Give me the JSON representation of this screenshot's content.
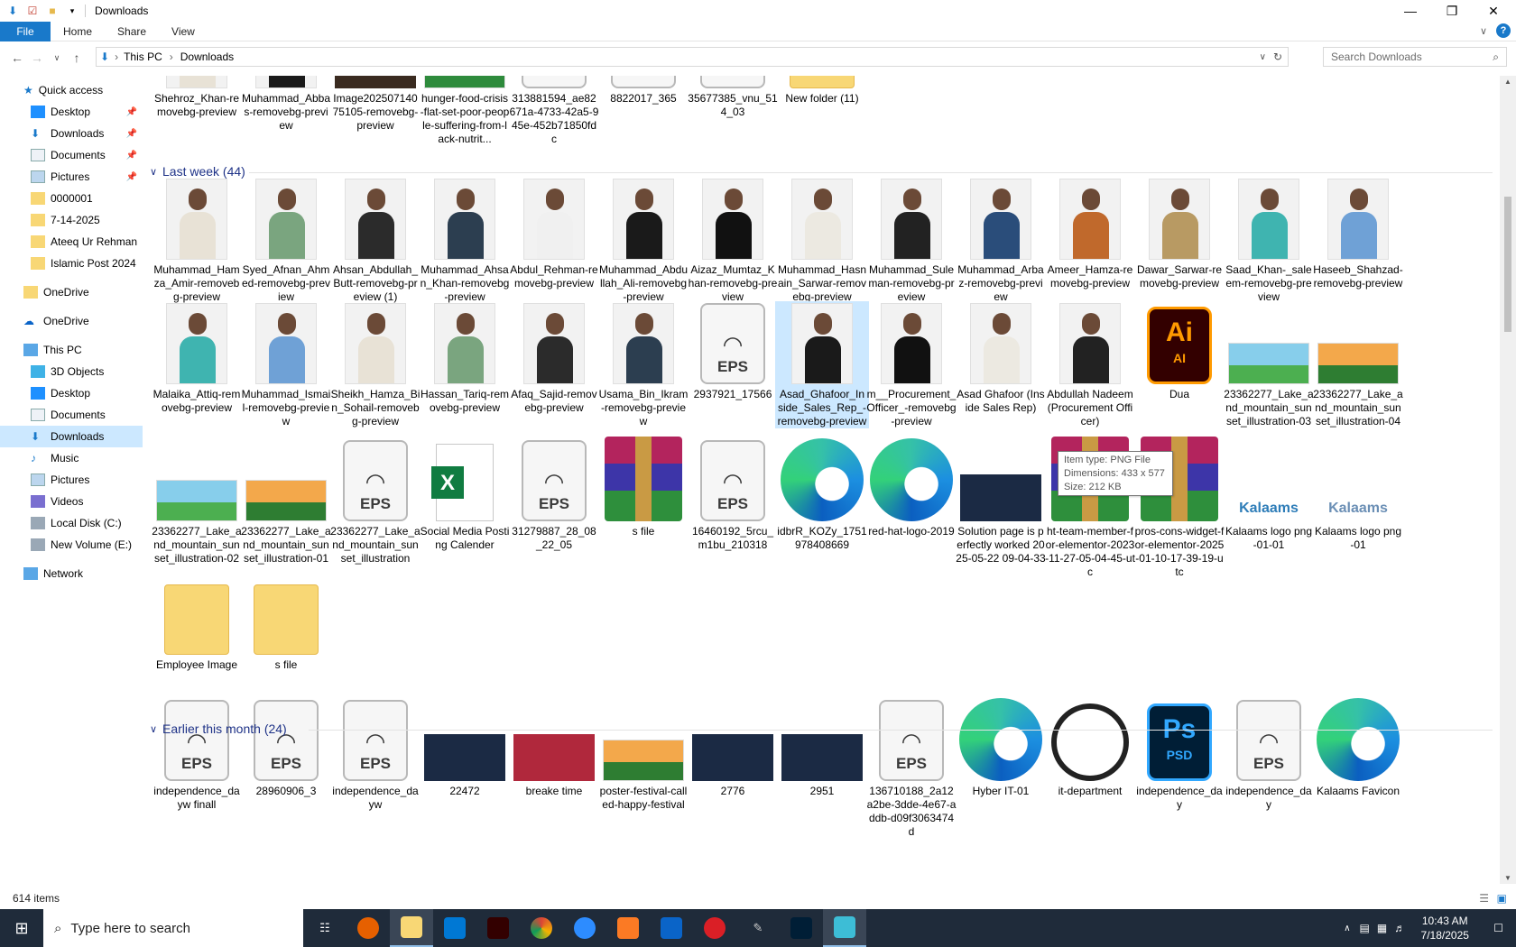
{
  "window": {
    "title": "Downloads"
  },
  "ribbon": {
    "tabs": [
      "File",
      "Home",
      "Share",
      "View"
    ]
  },
  "address": {
    "parts": [
      "This PC",
      "Downloads"
    ],
    "search_placeholder": "Search Downloads"
  },
  "nav": {
    "quick_access": "Quick access",
    "items": [
      {
        "label": "Desktop",
        "pinned": true
      },
      {
        "label": "Downloads",
        "pinned": true
      },
      {
        "label": "Documents",
        "pinned": true
      },
      {
        "label": "Pictures",
        "pinned": true
      },
      {
        "label": "0000001"
      },
      {
        "label": "7-14-2025"
      },
      {
        "label": "Ateeq Ur Rehman"
      },
      {
        "label": "Islamic Post 2024"
      }
    ],
    "onedrive1": "OneDrive",
    "onedrive2": "OneDrive",
    "this_pc": "This PC",
    "pc_items": [
      "3D Objects",
      "Desktop",
      "Documents",
      "Downloads",
      "Music",
      "Pictures",
      "Videos",
      "Local Disk (C:)",
      "New Volume (E:)"
    ],
    "network": "Network"
  },
  "groups": {
    "last_week": "Last week (44)",
    "earlier": "Earlier this month (24)"
  },
  "top_row": [
    "Shehroz_Khan-removebg-preview",
    "Muhammad_Abbas-removebg-preview",
    "Image20250714075105-removebg-preview",
    "hunger-food-crisis-flat-set-poor-people-suffering-from-lack-nutrit...",
    "313881594_ae82671a-4733-42a5-945e-452b71850fdc",
    "8822017_365",
    "35677385_vnu_514_03",
    "New folder (11)"
  ],
  "row1": [
    "Muhammad_Hamza_Amir-removebg-preview",
    "Syed_Afnan_Ahmed-removebg-preview",
    "Ahsan_Abdullah_Butt-removebg-preview (1)",
    "Muhammad_Ahsan_Khan-removebg-preview",
    "Abdul_Rehman-removebg-preview",
    "Muhammad_Abdullah_Ali-removebg-preview",
    "Aizaz_Mumtaz_Khan-removebg-preview",
    "Muhammad_Hasnain_Sarwar-removebg-preview",
    "Muhammad_Suleman-removebg-preview",
    "Muhammad_Arbaz-removebg-preview",
    "Ameer_Hamza-removebg-preview",
    "Dawar_Sarwar-removebg-preview",
    "Saad_Khan-_saleem-removebg-preview",
    "Haseeb_Shahzad-removebg-preview"
  ],
  "row2": [
    "Malaika_Attiq-removebg-preview",
    "Muhammad_Ismail-removebg-preview",
    "Sheikh_Hamza_Bin_Sohail-removebg-preview",
    "Hassan_Tariq-removebg-preview",
    "Afaq_Sajid-removebg-preview",
    "Usama_Bin_Ikram-removebg-preview",
    "2937921_17566",
    "Asad_Ghafoor_Inside_Sales_Rep_-removebg-preview",
    "m__Procurement_Officer_-removebg-preview",
    "Asad Ghafoor (Inside Sales Rep)",
    "Abdullah Nadeem (Procurement Officer)",
    "Dua",
    "23362277_Lake_and_mountain_sunset_illustration-03",
    "23362277_Lake_and_mountain_sunset_illustration-04"
  ],
  "row3": [
    "23362277_Lake_and_mountain_sunset_illustration-02",
    "23362277_Lake_and_mountain_sunset_illustration-01",
    "23362277_Lake_and_mountain_sunset_illustration",
    "Social Media Posting Calender",
    "31279887_28_08_22_05",
    "s file",
    "16460192_5rcu_m1bu_210318",
    "idbrR_KOZy_1751978408669",
    "red-hat-logo-2019",
    "Solution page is perfectly worked 2025-05-22 09-04-33",
    "ht-team-member-for-elementor-2023-11-27-05-04-45-utc",
    "pros-cons-widget-for-elementor-2025-01-10-17-39-19-utc",
    "Kalaams logo png-01-01",
    "Kalaams logo png-01"
  ],
  "row4": [
    "Employee Image",
    "s file"
  ],
  "row5": [
    "independence_dayw finall",
    "28960906_3",
    "independence_dayw",
    "22472",
    "breake time",
    "poster-festival-called-happy-festival",
    "2776",
    "2951",
    "136710188_2a12a2be-3dde-4e67-addb-d09f3063474d",
    "Hyber IT-01",
    "it-department",
    "independence_day",
    "independence_day",
    "Kalaams Favicon"
  ],
  "tooltip": {
    "line1": "Item type: PNG File",
    "line2": "Dimensions: 433 x 577",
    "line3": "Size: 212 KB"
  },
  "eps_label": "EPS",
  "ai_label": "Ai",
  "ai_sub": "AI",
  "ps_label": "Ps",
  "ps_sub": "PSD",
  "xl_label": "X",
  "kalaams_text": "Kalaams",
  "status": {
    "count": "614 items"
  },
  "taskbar": {
    "search_placeholder": "Type here to search",
    "time": "10:43 AM",
    "date": "7/18/2025"
  },
  "colors": {
    "accent": "#1979ca",
    "group": "#1e3287",
    "selection": "#cce8ff",
    "taskbar": "#1f2b3a"
  }
}
